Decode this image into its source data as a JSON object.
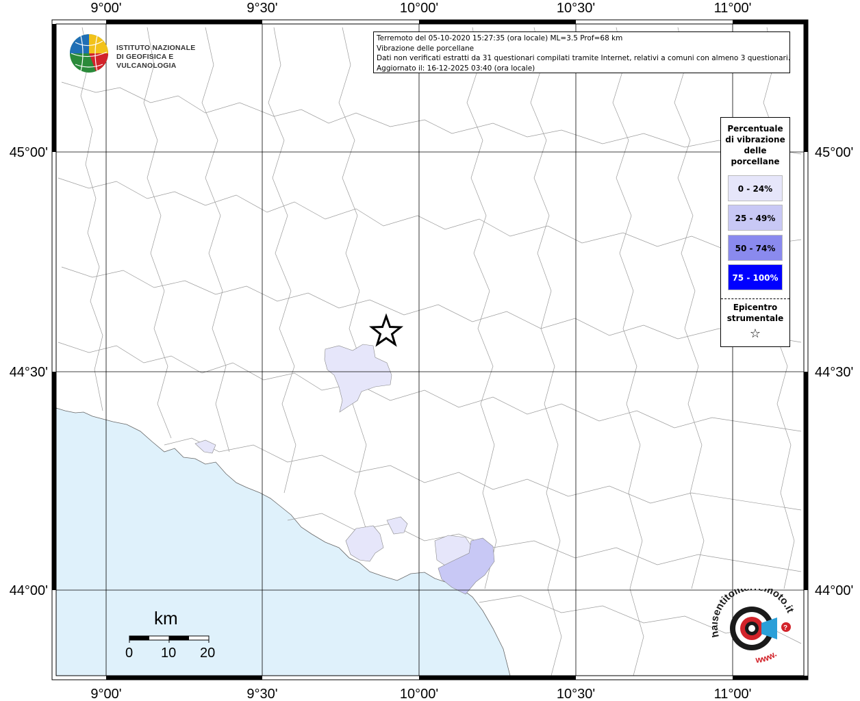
{
  "header": {
    "line1": "Terremoto del 05-10-2020 15:27:35 (ora locale) ML=3.5 Prof=68 km",
    "line2": "Vibrazione delle porcellane",
    "line3": "Dati non verificati estratti da 31 questionari compilati tramite Internet, relativi a comuni con almeno 3 questionari.",
    "line4": "Aggiornato il: 16-12-2025 03:40 (ora locale)"
  },
  "logo": {
    "line1": "ISTITUTO NAZIONALE",
    "line2": "DI GEOFISICA E VULCANOLOGIA"
  },
  "axes": {
    "lon_ticks": [
      "9°00'",
      "9°30'",
      "10°00'",
      "10°30'",
      "11°00'"
    ],
    "lat_ticks": [
      "45°00'",
      "44°30'",
      "44°00'"
    ]
  },
  "legend": {
    "title_lines": [
      "Percentuale",
      "di vibrazione",
      "delle",
      "porcellane"
    ],
    "classes": [
      {
        "label": "0 - 24%",
        "color": "#e6e6fa",
        "text_color": "#000000"
      },
      {
        "label": "25 - 49%",
        "color": "#c8c8f5",
        "text_color": "#000000"
      },
      {
        "label": "50 - 74%",
        "color": "#8a8aee",
        "text_color": "#000000"
      },
      {
        "label": "75 - 100%",
        "color": "#0000ff",
        "text_color": "#ffffff"
      }
    ],
    "epicenter_lines": [
      "Epicentro",
      "strumentale"
    ],
    "epicenter_symbol": "☆"
  },
  "scale": {
    "unit": "km",
    "labels": [
      "0",
      "10",
      "20"
    ]
  },
  "brand": {
    "text_top": "haisentitoilterremoto.it",
    "text_bottom": "www."
  },
  "colors": {
    "sea": "#dff1fb",
    "border": "#000000",
    "boundaries": "#999999"
  }
}
